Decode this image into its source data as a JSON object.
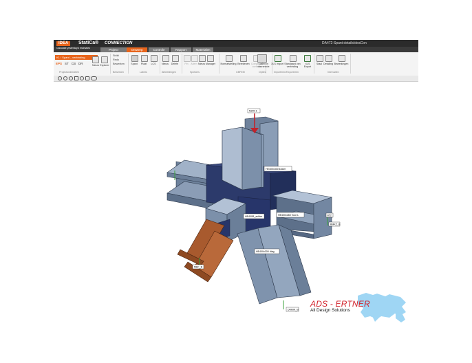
{
  "app": {
    "logo_idea": "IDEA",
    "logo_statica": "StatiCa®",
    "product": "CONNECTION",
    "tagline": "Calculate yesterday's estimates",
    "window_title": "DA472-Spant detailsIdeaCon"
  },
  "tabs": [
    {
      "label": "Project",
      "active": false
    },
    {
      "label": "Ontwerp",
      "active": true
    },
    {
      "label": "Controle",
      "active": false
    },
    {
      "label": "Rapport",
      "active": false
    },
    {
      "label": "Materialen",
      "active": false
    }
  ],
  "ribbon": {
    "selector_label": "K1 / Spant – verbinding",
    "types": [
      "EPS",
      "ST",
      "CB",
      "DR"
    ],
    "new_label": "Nieuw",
    "explorer_label": "Explorer",
    "opt1": "Strikt",
    "opt2": "Redo",
    "opt3": "Bewerken",
    "copy_label": "Spant",
    "paste_label": "Plaat",
    "lcs_label": "LCS",
    "new2_label": "Nieuw",
    "delete_label": "Delete",
    "pin_label": "Pin",
    "alt_label": "Altern",
    "new3_label": "Nieuw",
    "manager_label": "Manager",
    "norm_label": "Normafstelling",
    "rekenen_label": "Berekenen",
    "comp_label": "Complexe controle",
    "laden_label": "Laden in doorsnede",
    "xls_label": "XLS import",
    "wizard_label": "Standaard van verbinding",
    "xls2_label": "XLS Export",
    "staal_label": "Staal",
    "detail_label": "Detailing",
    "bewerk_label": "Bewerkingen",
    "groups": [
      "Projectonderdelen",
      "Bewerken",
      "Labels",
      "Afbeeldingen",
      "Spiekers",
      "CBFEM",
      "Opties",
      "Importeren/Exporteren",
      "Intervallen"
    ]
  },
  "scene": {
    "labels": {
      "top_load": "N200-1",
      "column": "HE400x300 kolom",
      "beam_left": "HE400B_achter",
      "beam_right": "HE400x260 Voor L",
      "diagonal": "HE400x300 diag",
      "load_right": "BMKZ_B",
      "load_bottom": "DMKIK_B",
      "load_left": "MEF_B",
      "load_side": "B52"
    },
    "colors": {
      "steel": "#7f93ad",
      "steel_dark": "#5a6e88",
      "node": "#24315c",
      "rust": "#a85a2e"
    }
  },
  "brand": {
    "name": "ADS - ERTNER",
    "subtitle": "All Design Solutions"
  }
}
